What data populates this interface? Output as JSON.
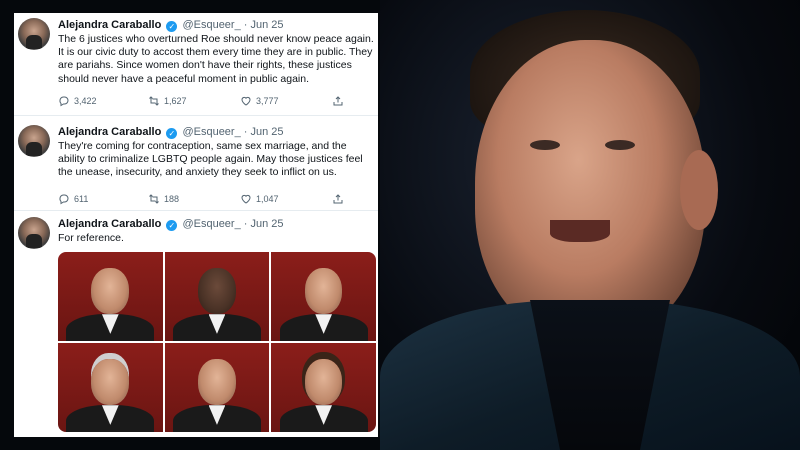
{
  "tweets": [
    {
      "name": "Alejandra Caraballo",
      "handle": "@Esqueer_",
      "date": "· Jun 25",
      "text": "The 6 justices who overturned Roe should never know peace again. It is our civic duty to accost them every time they are in public. They are pariahs. Since women don't have their rights, these justices should never have a peaceful moment in public again.",
      "replies": "3,422",
      "retweets": "1,627",
      "likes": "3,777"
    },
    {
      "name": "Alejandra Caraballo",
      "handle": "@Esqueer_",
      "date": "· Jun 25",
      "text": "They're coming for contraception, same sex marriage, and the ability to criminalize LGBTQ people again. May those justices feel the unease, insecurity, and anxiety they seek to inflict on us.",
      "replies": "611",
      "retweets": "188",
      "likes": "1,047"
    },
    {
      "name": "Alejandra Caraballo",
      "handle": "@Esqueer_",
      "date": "· Jun 25",
      "text": "For reference."
    }
  ],
  "icons": {
    "verified": "verified-badge-icon",
    "reply": "reply-icon",
    "retweet": "retweet-icon",
    "like": "heart-icon",
    "share": "share-icon"
  },
  "colors": {
    "verified": "#1d9bf0",
    "text": "#0f1419",
    "secondary": "#536471"
  }
}
